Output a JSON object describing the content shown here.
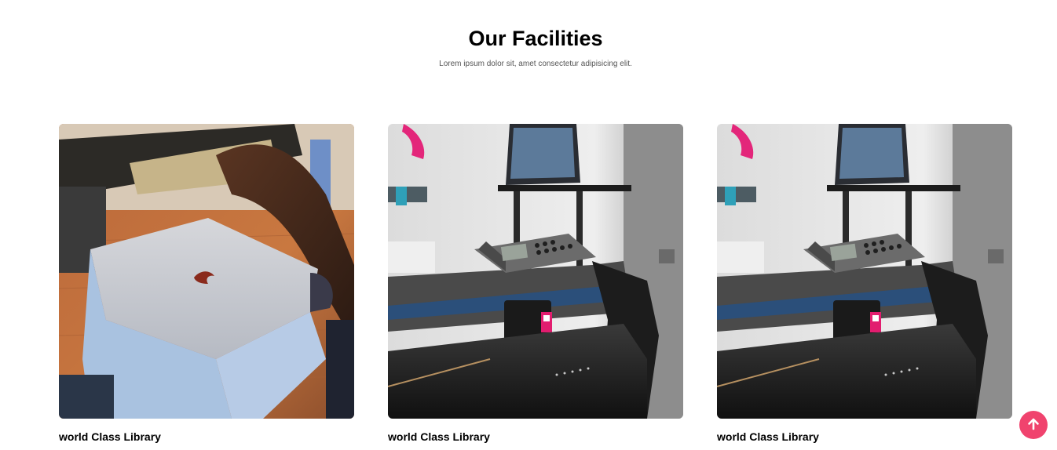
{
  "section": {
    "title": "Our Facilities",
    "subtitle": "Lorem ipsum dolor sit, amet consectetur adipisicing elit."
  },
  "cards": [
    {
      "caption": "world Class Library",
      "image": "screen-printing-press-photo"
    },
    {
      "caption": "world Class Library",
      "image": "vinyl-cutter-machine-photo"
    },
    {
      "caption": "world Class Library",
      "image": "vinyl-cutter-machine-photo"
    }
  ],
  "scroll_top": {
    "icon": "arrow-up-icon",
    "color": "#f0436e"
  }
}
